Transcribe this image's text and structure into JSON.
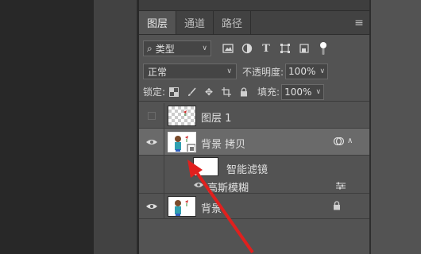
{
  "tabs": [
    "图层",
    "通道",
    "路径"
  ],
  "filter": {
    "kind_label": "类型"
  },
  "blend": {
    "mode": "正常",
    "opacity_label": "不透明度:",
    "opacity_value": "100%"
  },
  "lock": {
    "label": "锁定:",
    "fill_label": "填充:",
    "fill_value": "100%"
  },
  "layers": {
    "layer1": {
      "name": "图层 1"
    },
    "copy": {
      "name": "背景 拷贝"
    },
    "smart_filter": {
      "label": "智能滤镜",
      "filter_name": "高斯模糊"
    },
    "background": {
      "name": "背景"
    }
  },
  "annotation": {
    "arrow_color": "#e0201e"
  }
}
